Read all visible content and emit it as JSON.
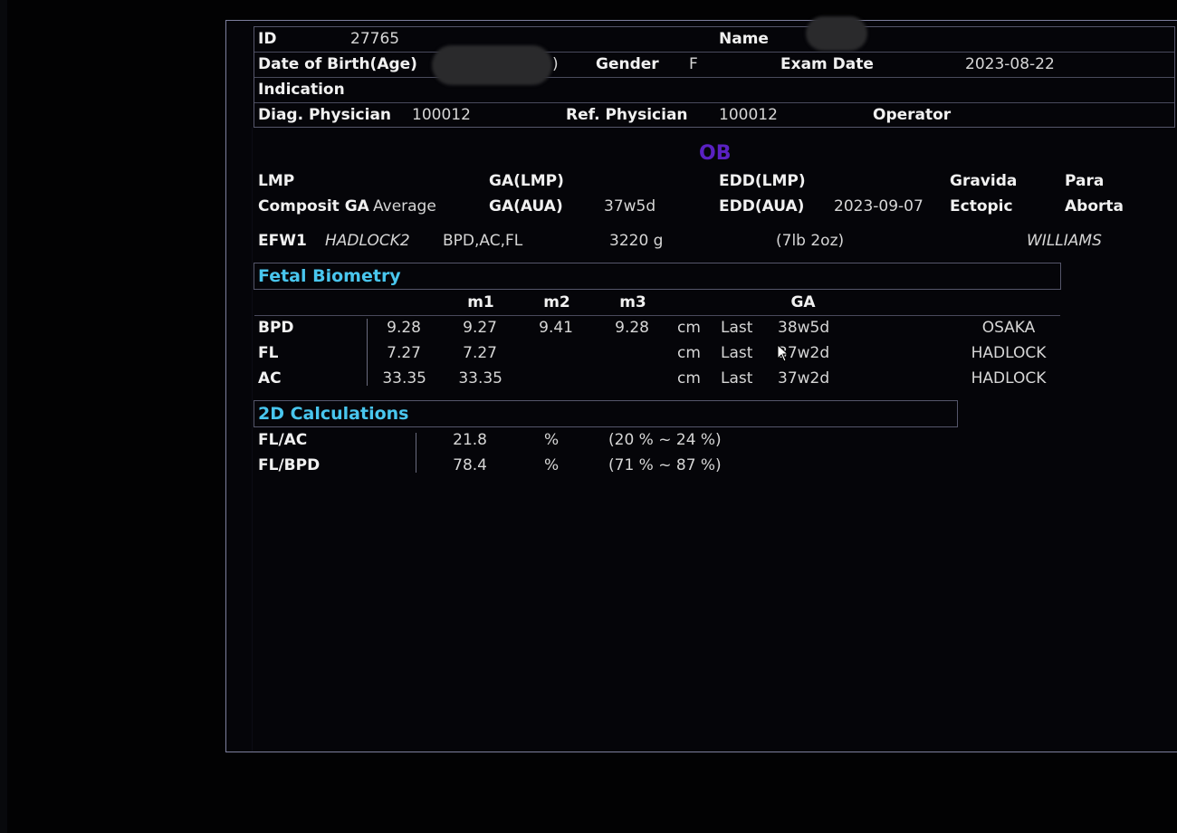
{
  "header": {
    "id_label": "ID",
    "id_value": "27765",
    "name_label": "Name",
    "dob_label": "Date of Birth(Age)",
    "dob_tail": ")",
    "gender_label": "Gender",
    "gender_value": "F",
    "exam_date_label": "Exam Date",
    "exam_date_value": "2023-08-22",
    "indication_label": "Indication",
    "diag_label": "Diag. Physician",
    "diag_value": "100012",
    "ref_label": "Ref. Physician",
    "ref_value": "100012",
    "operator_label": "Operator"
  },
  "ob": {
    "title": "OB",
    "lmp_label": "LMP",
    "ga_lmp_label": "GA(LMP)",
    "edd_lmp_label": "EDD(LMP)",
    "gravida_label": "Gravida",
    "para_label": "Para",
    "composit_label": "Composit GA",
    "composit_value": "Average",
    "ga_aua_label": "GA(AUA)",
    "ga_aua_value": "37w5d",
    "edd_aua_label": "EDD(AUA)",
    "edd_aua_value": "2023-09-07",
    "ectopic_label": "Ectopic",
    "aborta_label": "Aborta",
    "efw_label": "EFW1",
    "efw_method": "HADLOCK2",
    "efw_params": "BPD,AC,FL",
    "efw_value": "3220 g",
    "efw_imperial": "(7lb 2oz)",
    "efw_ref": "WILLIAMS"
  },
  "biometry": {
    "title": "Fetal Biometry",
    "headers": {
      "m1": "m1",
      "m2": "m2",
      "m3": "m3",
      "ga": "GA"
    },
    "rows": [
      {
        "name": "BPD",
        "avg": "9.28",
        "m1": "9.27",
        "m2": "9.41",
        "m3": "9.28",
        "unit": "cm",
        "method": "Last",
        "ga": "38w5d",
        "author": "OSAKA"
      },
      {
        "name": "FL",
        "avg": "7.27",
        "m1": "7.27",
        "m2": "",
        "m3": "",
        "unit": "cm",
        "method": "Last",
        "ga": "37w2d",
        "author": "HADLOCK"
      },
      {
        "name": "AC",
        "avg": "33.35",
        "m1": "33.35",
        "m2": "",
        "m3": "",
        "unit": "cm",
        "method": "Last",
        "ga": "37w2d",
        "author": "HADLOCK"
      }
    ]
  },
  "calc": {
    "title": "2D Calculations",
    "rows": [
      {
        "name": "FL/AC",
        "value": "21.8",
        "unit": "%",
        "range": "(20 % ~ 24 %)"
      },
      {
        "name": "FL/BPD",
        "value": "78.4",
        "unit": "%",
        "range": "(71 % ~ 87 %)"
      }
    ]
  },
  "icons": {
    "cursor": "mouse-pointer-icon"
  },
  "colors": {
    "section_title": "#49c6ee",
    "ob_title": "#5a21c2",
    "background": "#050509",
    "border": "#7d7f9e"
  }
}
